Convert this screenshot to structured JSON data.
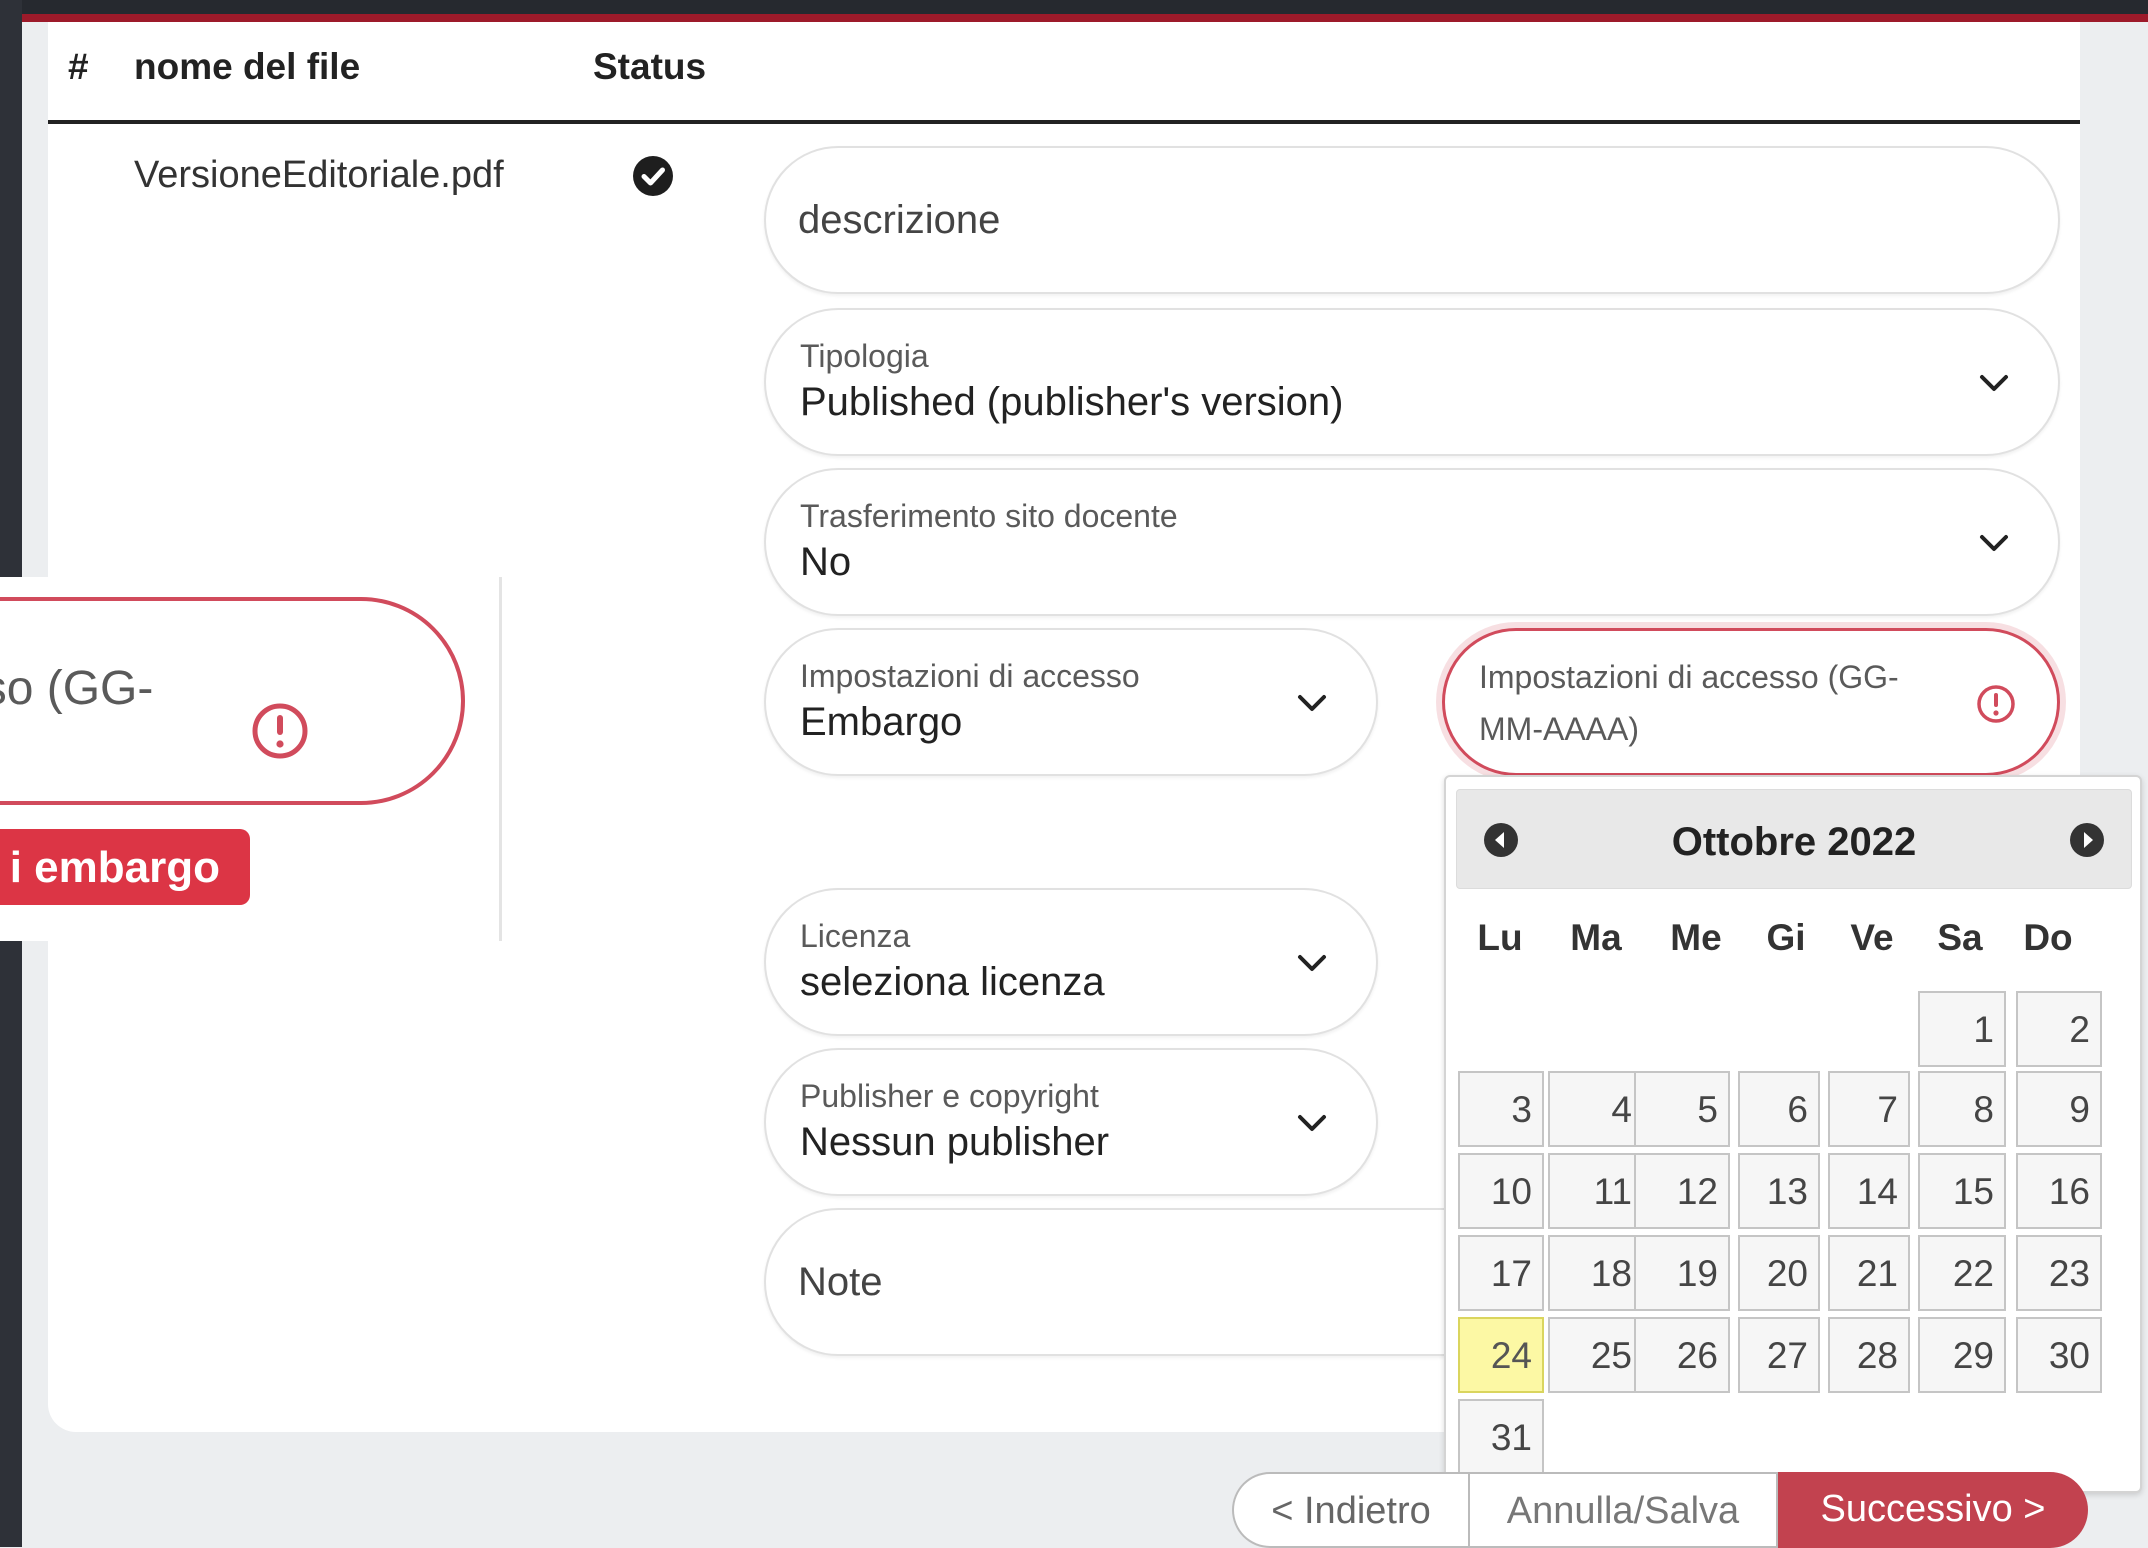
{
  "table": {
    "col_num": "#",
    "col_name": "nome del file",
    "col_status": "Status",
    "row": {
      "filename": "VersioneEditoriale.pdf"
    }
  },
  "form": {
    "descrizione_placeholder": "descrizione",
    "tipologia": {
      "label": "Tipologia",
      "value": "Published (publisher's version)"
    },
    "trasferimento": {
      "label": "Trasferimento sito docente",
      "value": "No"
    },
    "accesso": {
      "label": "Impostazioni di accesso",
      "value": "Embargo"
    },
    "data_accesso": {
      "label": "Impostazioni di accesso (GG-MM-AAAA)"
    },
    "licenza": {
      "label": "Licenza",
      "value": "seleziona licenza"
    },
    "publisher": {
      "label": "Publisher e copyright",
      "value": "Nessun publisher"
    },
    "note_placeholder": "Note"
  },
  "zoom": {
    "field_text": "ccesso (GG-",
    "button_text": "i embargo"
  },
  "calendar": {
    "title": "Ottobre 2022",
    "weekdays": [
      "Lu",
      "Ma",
      "Me",
      "Gi",
      "Ve",
      "Sa",
      "Do"
    ],
    "today": 24,
    "days": [
      1,
      2,
      3,
      4,
      5,
      6,
      7,
      8,
      9,
      10,
      11,
      12,
      13,
      14,
      15,
      16,
      17,
      18,
      19,
      20,
      21,
      22,
      23,
      24,
      25,
      26,
      27,
      28,
      29,
      30,
      31
    ],
    "start_weekday_index": 5
  },
  "buttons": {
    "back": "< Indietro",
    "cancel": "Annulla/Salva",
    "next": "Successivo >"
  },
  "colors": {
    "accent": "#c2424f",
    "error": "#d14b5c",
    "today_bg": "#fcf8a4",
    "top_bar": "#9d1a2a"
  }
}
